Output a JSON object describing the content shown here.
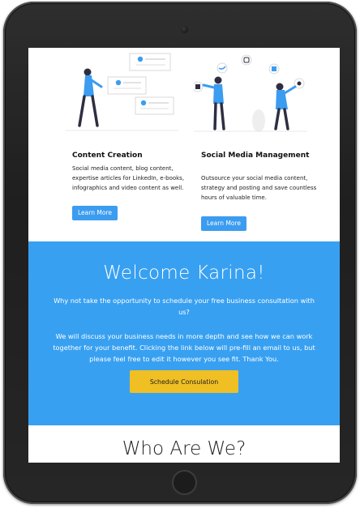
{
  "services": [
    {
      "title": "Content Creation",
      "description": "Social media content, blog content, expertise articles for LinkedIn, e-books, infographics and video content as well.",
      "button_label": "Learn More",
      "illustration": "person-with-cards-illustration"
    },
    {
      "title": "Social Media Management",
      "description": "Outsource your social media content, strategy and posting and save countless hours of valuable time.",
      "button_label": "Learn More",
      "illustration": "social-media-icons-illustration"
    }
  ],
  "welcome": {
    "title": "Welcome Karina!",
    "paragraph1": "Why not take the opportunity to schedule your free business consultation with us?",
    "paragraph2": "We will discuss your business needs in more depth and see how we can work together for your benefit. Clicking the link below will pre-fill an email to us, but please feel free to edit it however you see fit. Thank You.",
    "button_label": "Schedule Consulation"
  },
  "about": {
    "title": "Who Are We?"
  },
  "colors": {
    "accent_blue": "#38a0f1",
    "button_blue": "#3b9cf0",
    "button_yellow": "#efbf24",
    "device_frame": "#262626"
  }
}
